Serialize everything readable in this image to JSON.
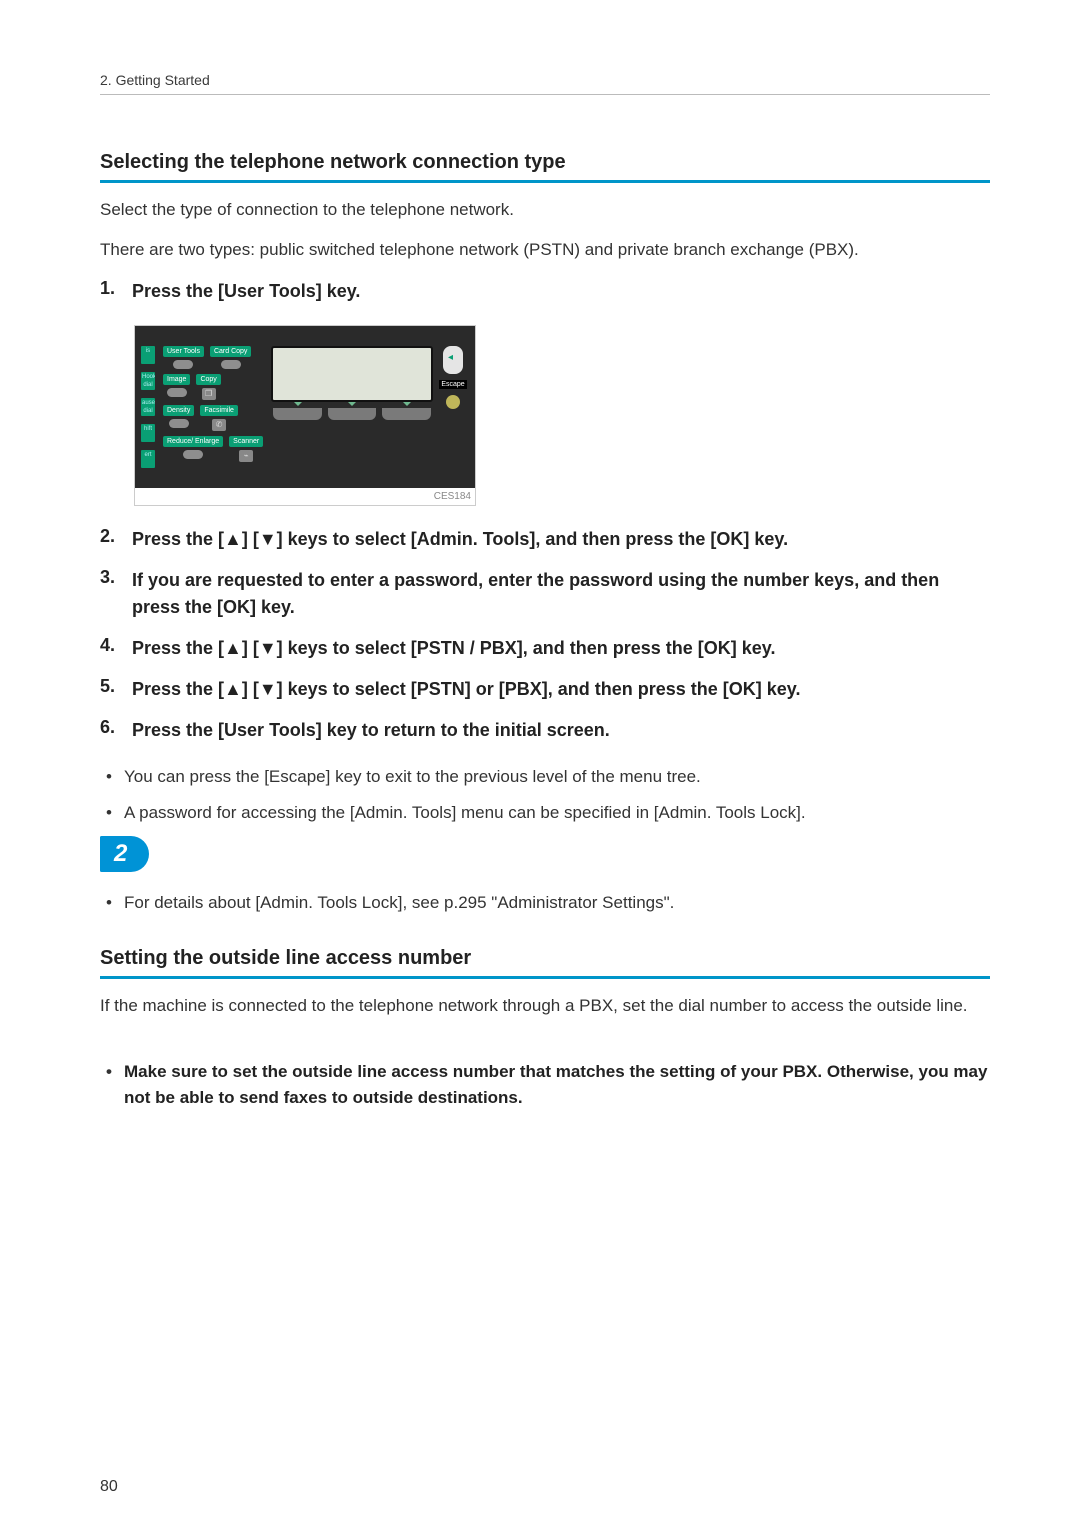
{
  "header": {
    "chapter": "2. Getting Started"
  },
  "section1": {
    "title": "Selecting the telephone network connection type",
    "p1": "Select the type of connection to the telephone network.",
    "p2": "There are two types: public switched telephone network (PSTN) and private branch exchange (PBX).",
    "steps": [
      "Press the [User Tools] key.",
      "Press the [▲] [▼] keys to select [Admin. Tools], and then press the [OK] key.",
      "If you are requested to enter a password, enter the password using the number keys, and then press the [OK] key.",
      "Press the [▲] [▼] keys to select [PSTN / PBX], and then press the [OK] key.",
      "Press the [▲] [▼] keys to select [PSTN] or [PBX], and then press the [OK] key.",
      "Press the [User Tools] key to return to the initial screen."
    ],
    "notes": [
      "You can press the [Escape] key to exit to the previous level of the menu tree.",
      "A password for accessing the [Admin. Tools] menu can be specified in [Admin. Tools Lock]."
    ],
    "ref": "For details about [Admin. Tools Lock], see p.295 \"Administrator Settings\"."
  },
  "figure": {
    "caption": "CES184",
    "labels": {
      "user_tools": "User Tools",
      "card_copy": "Card Copy",
      "image": "Image",
      "copy": "Copy",
      "density": "Density",
      "facsimile": "Facsimile",
      "reduce_enlarge": "Reduce/\nEnlarge",
      "scanner": "Scanner",
      "escape": "Escape",
      "side": {
        "a": "is",
        "b": "Hook\ndial",
        "c": "ause/\ndial",
        "d": "hift",
        "e": "ert"
      }
    }
  },
  "tab": {
    "number": "2"
  },
  "section2": {
    "title": "Setting the outside line access number",
    "p1": "If the machine is connected to the telephone network through a PBX, set the dial number to access the outside line.",
    "warning": "Make sure to set the outside line access number that matches the setting of your PBX. Otherwise, you may not be able to send faxes to outside destinations."
  },
  "page_number": "80"
}
